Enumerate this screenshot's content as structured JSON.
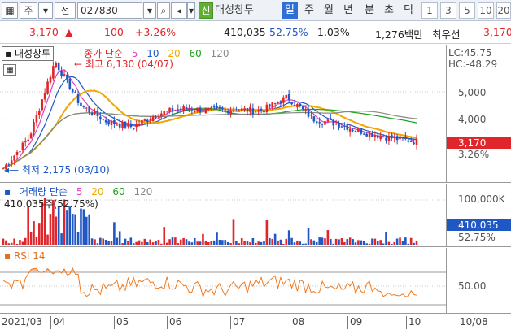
{
  "toolbar": {
    "market_label": "주",
    "type_label": "전",
    "code": "027830",
    "flag_label": "신",
    "stock_name": "대성창투",
    "period_tabs": [
      "일",
      "주",
      "월",
      "년",
      "분",
      "초",
      "틱"
    ],
    "active_period": "일",
    "intervals": [
      "1",
      "3",
      "5",
      "10",
      "20"
    ]
  },
  "quote": {
    "price": "3,170",
    "change": "100",
    "change_pct": "+3.26%",
    "volume": "410,035",
    "ratio": "52.75%",
    "turnover": "1.03%",
    "amount": "1,276백만",
    "status": "최우선",
    "best_price": "3,170"
  },
  "price_panel": {
    "title": "대성창투",
    "legend_prefix": "종가 단순",
    "ma_periods": [
      "5",
      "10",
      "20",
      "60",
      "120"
    ],
    "high_label": "최고 6,130 (04/07)",
    "low_label": "최저 2,175 (03/10)",
    "lc": "LC:45.75",
    "hc": "HC:-48.29",
    "y_ticks": [
      "5,000",
      "4,000"
    ],
    "price_tag": "3,170",
    "pct_tag": "3.26%"
  },
  "volume_panel": {
    "legend_prefix": "거래량 단순",
    "ma_periods": [
      "5",
      "20",
      "60",
      "120"
    ],
    "value_label": "410,035주(52.75%)",
    "y_tick": "100,000K",
    "volume_tag": "410,035",
    "pct_tag": "52.75%"
  },
  "rsi_panel": {
    "label": "RSI 14",
    "y_tick": "50.00"
  },
  "x_axis": {
    "labels": [
      "2021/03",
      "04",
      "05",
      "06",
      "07",
      "08",
      "09",
      "10"
    ],
    "right_label": "10/08"
  },
  "colors": {
    "up": "#e0262a",
    "down": "#1f57c4",
    "ma5": "#e040c0",
    "ma10": "#1f57c4",
    "ma20": "#f0a800",
    "ma60": "#19a319",
    "ma120": "#888888",
    "rsi": "#f07a20",
    "active_tab": "#2f6fd6"
  },
  "chart_data": {
    "type": "line",
    "x": [
      "2021/03/10",
      "03/25",
      "04/07",
      "04/20",
      "05/03",
      "05/17",
      "05/31",
      "06/14",
      "06/28",
      "07/12",
      "07/26",
      "08/09",
      "08/23",
      "09/06",
      "09/20",
      "10/04",
      "10/08"
    ],
    "series": [
      {
        "name": "종가",
        "values": [
          2175,
          3300,
          6130,
          4500,
          3900,
          3700,
          4200,
          4400,
          4300,
          4350,
          4300,
          4800,
          4000,
          3800,
          3500,
          3300,
          3170
        ]
      }
    ],
    "ylim": [
      2000,
      6500
    ]
  }
}
